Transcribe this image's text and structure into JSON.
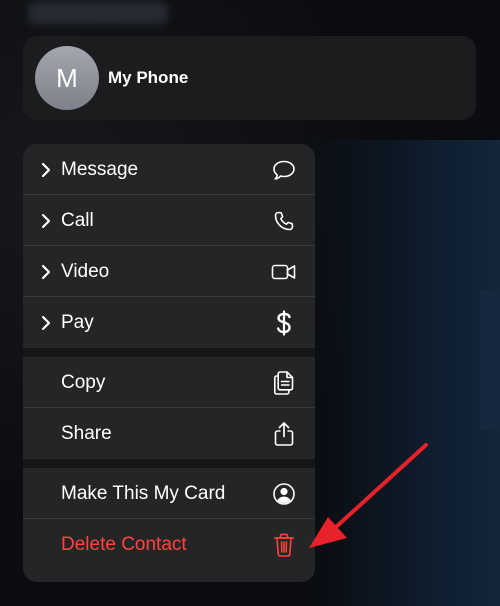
{
  "contact": {
    "initial": "M",
    "name": "My Phone"
  },
  "menu": {
    "groups": [
      {
        "items": [
          {
            "label": "Message",
            "icon": "message-bubble-icon",
            "submenu": true
          },
          {
            "label": "Call",
            "icon": "phone-icon",
            "submenu": true
          },
          {
            "label": "Video",
            "icon": "video-camera-icon",
            "submenu": true
          },
          {
            "label": "Pay",
            "icon": "dollar-icon",
            "submenu": true
          }
        ]
      },
      {
        "items": [
          {
            "label": "Copy",
            "icon": "copy-icon",
            "submenu": false
          },
          {
            "label": "Share",
            "icon": "share-icon",
            "submenu": false
          }
        ]
      },
      {
        "items": [
          {
            "label": "Make This My Card",
            "icon": "person-circle-icon",
            "submenu": false
          },
          {
            "label": "Delete Contact",
            "icon": "trash-icon",
            "submenu": false,
            "destructive": true
          }
        ]
      }
    ]
  },
  "colors": {
    "destructive": "#ff453a",
    "annotation_arrow": "#e8222a",
    "menu_background": "#252527"
  }
}
